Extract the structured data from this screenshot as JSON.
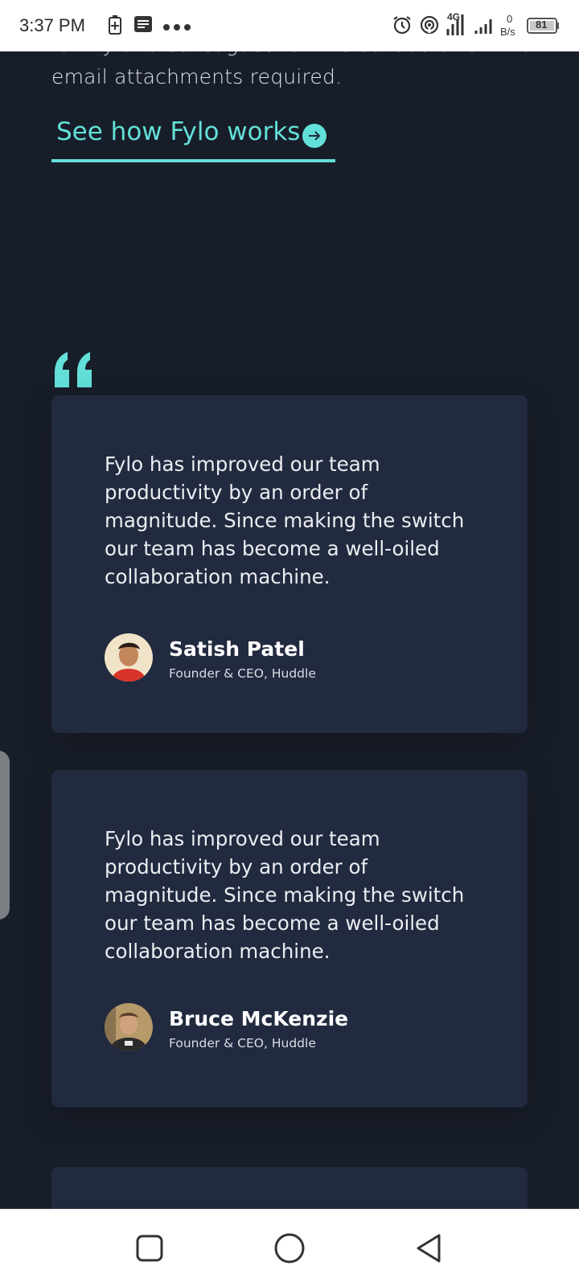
{
  "status_bar": {
    "time": "3:37 PM",
    "network_label": "4G",
    "speed_value": "0",
    "speed_unit": "B/s",
    "battery_level": "81",
    "icons": [
      "battery-saver-icon",
      "message-icon",
      "more-dots-icon",
      "alarm-icon",
      "hotspot-icon",
      "signal-4g-icon",
      "signal-icon",
      "battery-icon"
    ]
  },
  "intro": {
    "partial_line": "family and colleagues for live collaboration. No",
    "last_line": "email attachments required."
  },
  "cta": {
    "label": "See how Fylo works",
    "icon": "arrow-circle-icon"
  },
  "testimonials": [
    {
      "quote": "Fylo has improved our team productivity by an order of magnitude. Since making the switch our team has become a well-oiled collaboration machine.",
      "name": "Satish Patel",
      "role": "Founder & CEO, Huddle",
      "avatar": "avatar-satish"
    },
    {
      "quote": "Fylo has improved our team productivity by an order of magnitude. Since making the switch our team has become a well-oiled collaboration machine.",
      "name": "Bruce McKenzie",
      "role": "Founder & CEO, Huddle",
      "avatar": "avatar-bruce"
    }
  ],
  "colors": {
    "page_background": "#181e29",
    "card_background": "#212a3f",
    "accent": "#62e0d9",
    "text": "#ecedf1"
  },
  "nav": {
    "buttons": [
      "recents-square-icon",
      "home-circle-icon",
      "back-triangle-icon"
    ]
  }
}
